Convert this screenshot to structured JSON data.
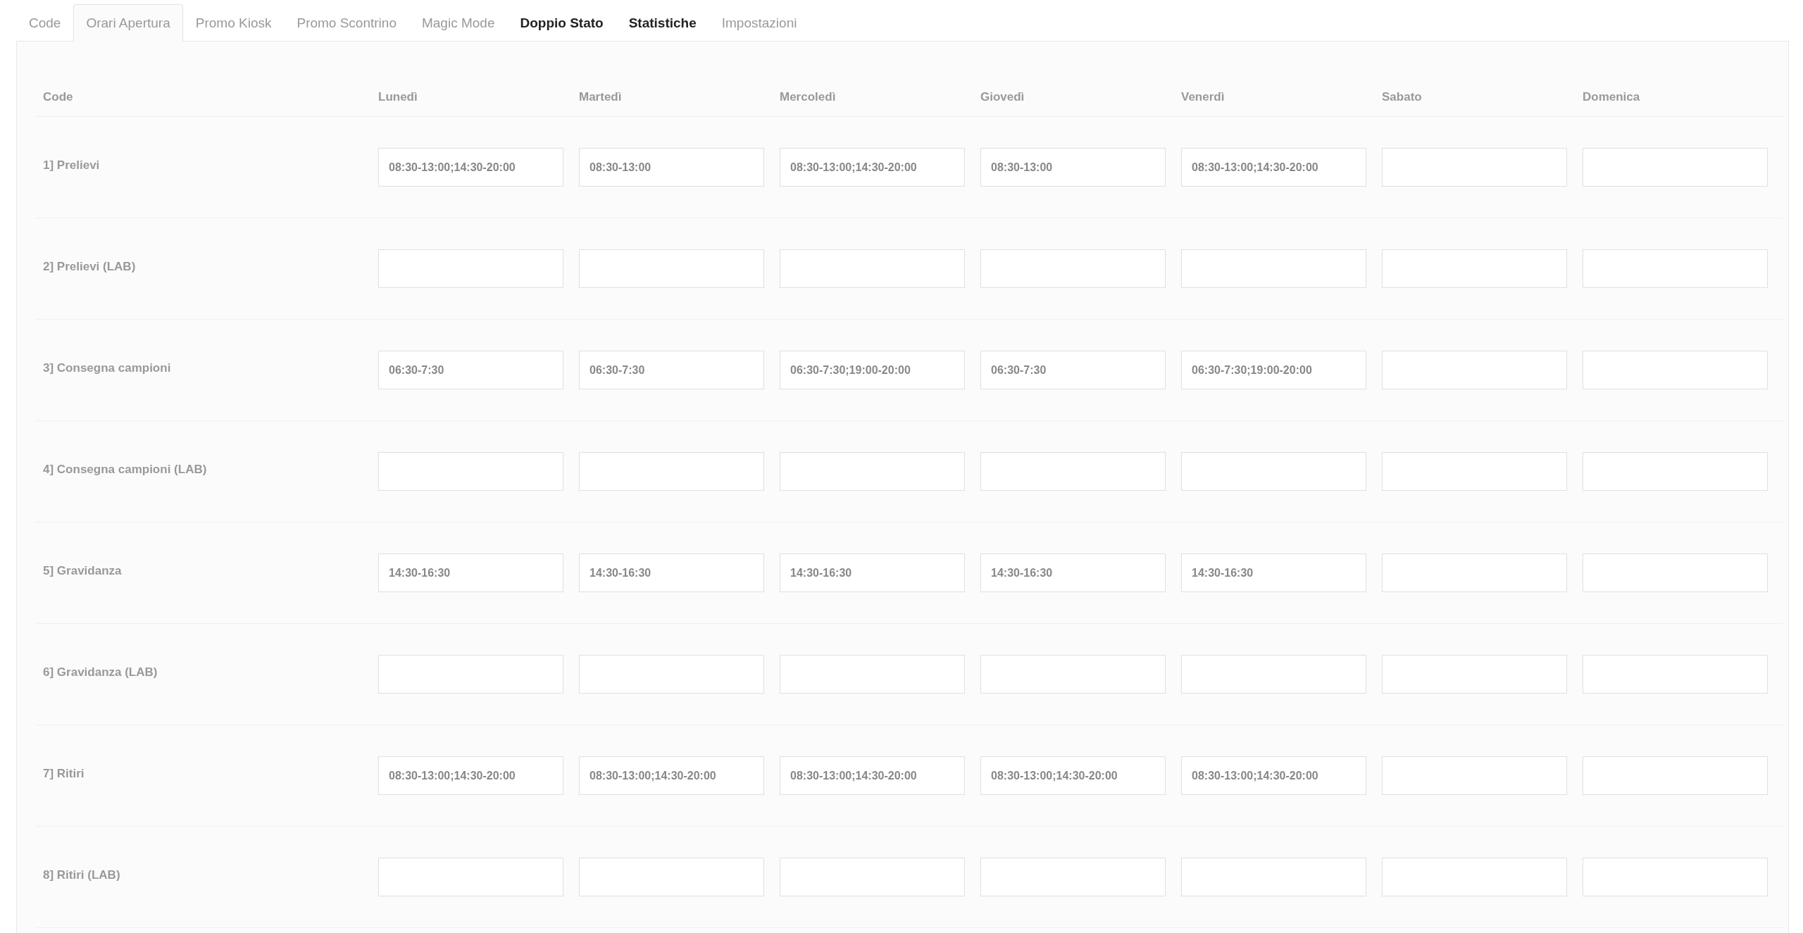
{
  "tabs": [
    {
      "label": "Code",
      "selected": false,
      "emphasized": false
    },
    {
      "label": "Orari Apertura",
      "selected": true,
      "emphasized": false
    },
    {
      "label": "Promo Kiosk",
      "selected": false,
      "emphasized": false
    },
    {
      "label": "Promo Scontrino",
      "selected": false,
      "emphasized": false
    },
    {
      "label": "Magic Mode",
      "selected": false,
      "emphasized": false
    },
    {
      "label": "Doppio Stato",
      "selected": false,
      "emphasized": true
    },
    {
      "label": "Statistiche",
      "selected": false,
      "emphasized": true
    },
    {
      "label": "Impostazioni",
      "selected": false,
      "emphasized": false
    }
  ],
  "table": {
    "row_header": "Code",
    "columns": [
      "Lunedì",
      "Martedì",
      "Mercoledì",
      "Giovedì",
      "Venerdì",
      "Sabato",
      "Domenica"
    ],
    "rows": [
      {
        "name": "1] Prelievi",
        "cells": [
          {
            "value": "08:30-13:00;14:30-20:00"
          },
          {
            "value": "08:30-13:00"
          },
          {
            "value": "08:30-13:00;14:30-20:00"
          },
          {
            "value": "08:30-13:00"
          },
          {
            "value": "08:30-13:00;14:30-20:00"
          },
          {},
          {}
        ]
      },
      {
        "name": "2] Prelievi (LAB)",
        "cells": [
          {},
          {},
          {},
          {},
          {},
          {},
          {}
        ]
      },
      {
        "name": "3] Consegna campioni",
        "cells": [
          {
            "value": "06:30-7:30"
          },
          {
            "value": "06:30-7:30"
          },
          {
            "value": "06:30-7:30;19:00-20:00"
          },
          {
            "value": "06:30-7:30"
          },
          {
            "value": "06:30-7:30;19:00-20:00"
          },
          {},
          {}
        ]
      },
      {
        "name": "4] Consegna campioni (LAB)",
        "cells": [
          {},
          {},
          {},
          {},
          {},
          {},
          {}
        ]
      },
      {
        "name": "5] Gravidanza",
        "cells": [
          {
            "value": "14:30-16:30"
          },
          {
            "value": "14:30-16:30"
          },
          {
            "value": "14:30-16:30"
          },
          {
            "value": "14:30-16:30"
          },
          {
            "value": "14:30-16:30"
          },
          {},
          {}
        ]
      },
      {
        "name": "6] Gravidanza (LAB)",
        "cells": [
          {},
          {},
          {},
          {},
          {},
          {},
          {}
        ]
      },
      {
        "name": "7] Ritiri",
        "cells": [
          {
            "value": "08:30-13:00;14:30-20:00"
          },
          {
            "value": "08:30-13:00;14:30-20:00"
          },
          {
            "value": "08:30-13:00;14:30-20:00"
          },
          {
            "value": "08:30-13:00;14:30-20:00"
          },
          {
            "value": "08:30-13:00;14:30-20:00"
          },
          {},
          {}
        ]
      },
      {
        "name": "8] Ritiri (LAB)",
        "cells": [
          {},
          {},
          {},
          {},
          {},
          {},
          {}
        ]
      }
    ]
  }
}
